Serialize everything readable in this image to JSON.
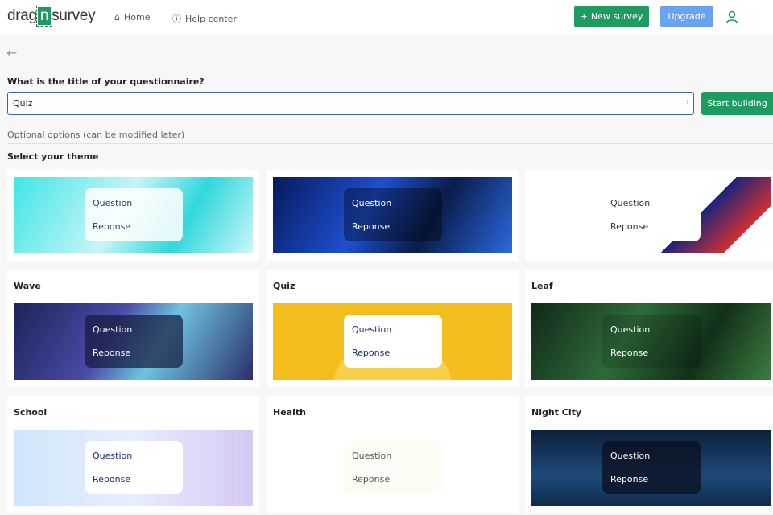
{
  "header": {
    "logo_left": "drag",
    "logo_mid": "n",
    "logo_right": "survey",
    "home": "Home",
    "help": "Help center",
    "new_survey": "New survey",
    "upgrade": "Upgrade"
  },
  "form": {
    "question": "What is the title of your questionnaire?",
    "title_value": "Quiz",
    "start": "Start building",
    "optional": "Optional options (can be modified later)",
    "select_theme": "Select your theme"
  },
  "themes": [
    {
      "name": "",
      "q": "Question",
      "r": "Reponse",
      "bg": "linear-gradient(120deg,#3fe6e6,#c8f4f7 45%,#30d8dc 70%,#cdf6f8)",
      "box": "rgba(255,255,255,0.85)",
      "fg": "#2f3a6e"
    },
    {
      "name": "",
      "q": "Question",
      "r": "Reponse",
      "bg": "linear-gradient(120deg,#061a5c,#1e4fd0 40%,#0a1c4a 65%,#2a6ae0)",
      "box": "rgba(0,0,0,0.35)",
      "fg": "#ffffff"
    },
    {
      "name": "",
      "q": "Question",
      "r": "Reponse",
      "bg": "linear-gradient(135deg,#fff 65%,#1a237e 65%,#d32f2f 85%,#fff 85%)",
      "box": "#ffffff",
      "fg": "#333333"
    },
    {
      "name": "Wave",
      "q": "Question",
      "r": "Reponse",
      "bg": "linear-gradient(120deg,#1b2457,#4a4aa8 40%,#6fc3df 60%,#2a2f6a)",
      "box": "rgba(20,25,60,0.7)",
      "fg": "#ffffff"
    },
    {
      "name": "Quiz",
      "q": "Question",
      "r": "Reponse",
      "bg": "radial-gradient(circle at 50% 120%,#f7d04a 40%,#f3bd1e 41%)",
      "box": "#ffffff",
      "fg": "#1a2a6c"
    },
    {
      "name": "Leaf",
      "q": "Question",
      "r": "Reponse",
      "bg": "linear-gradient(120deg,#0f2a18,#2f6a3a 40%,#123018 70%,#3c7c40)",
      "box": "rgba(0,0,0,0.15)",
      "fg": "#ffffff"
    },
    {
      "name": "School",
      "q": "Question",
      "r": "Reponse",
      "bg": "linear-gradient(90deg,#cfe6fb,#e6eefc 50%,#d6c8f5)",
      "box": "#ffffff",
      "fg": "#1a2a6c"
    },
    {
      "name": "Health",
      "q": "Question",
      "r": "Reponse",
      "bg": "#ffffff",
      "box": "#fdfcf5",
      "fg": "#555555"
    },
    {
      "name": "Night City",
      "q": "Question",
      "r": "Reponse",
      "bg": "linear-gradient(180deg,#0b1f3a,#1d4a7a 60%,#0e2a4a)",
      "box": "rgba(10,15,30,0.75)",
      "fg": "#ffffff"
    }
  ]
}
